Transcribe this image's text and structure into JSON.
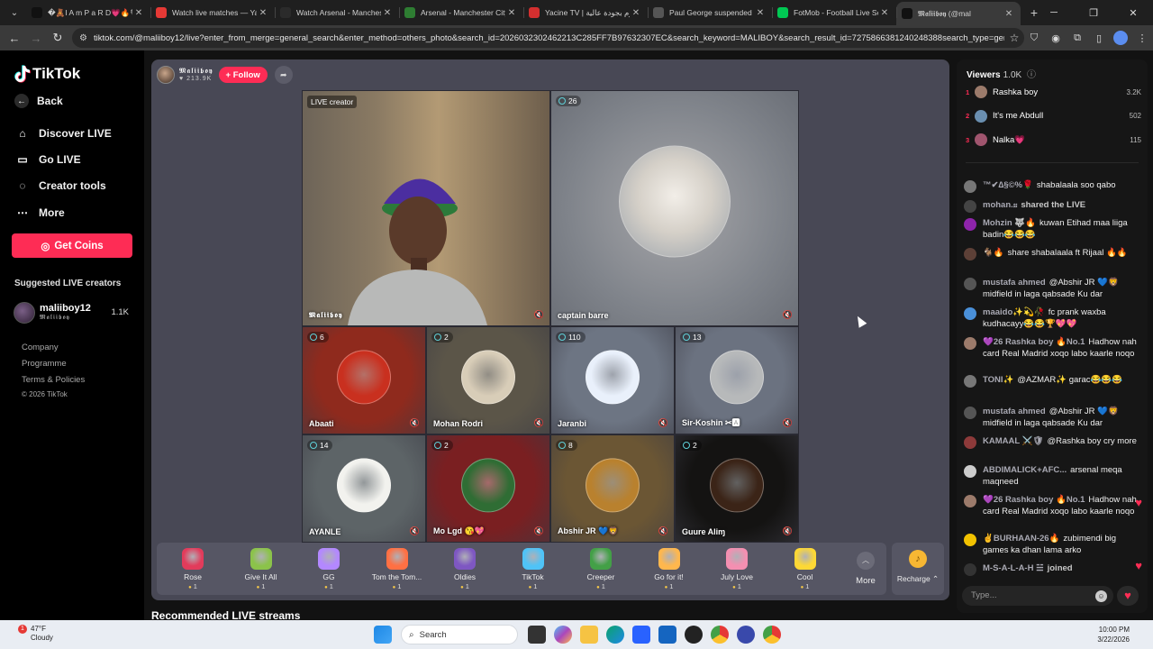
{
  "browser": {
    "tabs": [
      {
        "label": "�🧸I A m P a R D💗🔥🕊",
        "active": false,
        "favicon_color": "#111111",
        "icon": "tiktok-icon"
      },
      {
        "label": "Watch live matches — Ya",
        "active": false,
        "favicon_color": "#e53935",
        "icon": "y-icon"
      },
      {
        "label": "Watch Arsenal - Manches",
        "active": false,
        "favicon_color": "#2b2b2b",
        "icon": "check-icon"
      },
      {
        "label": "Arsenal - Manchester City",
        "active": false,
        "favicon_color": "#2e7d32",
        "icon": "s-icon"
      },
      {
        "label": "Yacine TV | يوم بجودة عالية",
        "active": false,
        "favicon_color": "#d32f2f",
        "icon": "y-icon"
      },
      {
        "label": "Paul George suspended f",
        "active": false,
        "favicon_color": "#555555",
        "icon": "globe-icon"
      },
      {
        "label": "FotMob - Football Live Sc",
        "active": false,
        "favicon_color": "#00c853",
        "icon": "fotmob-icon"
      },
      {
        "label": "𝕸𝖆𝖑𝖎𝖎𝖇𝖔𝖞 (@mal",
        "active": true,
        "favicon_color": "#111111",
        "icon": "tiktok-icon"
      }
    ],
    "new_tab": "+",
    "url": "tiktok.com/@maliiboy12/live?enter_from_merge=general_search&enter_method=others_photo&search_id=2026032302462213C285FF7B97632307EC&search_keyword=MALIBOY&search_result_id=7275866381240248388search_type=general"
  },
  "sidebar": {
    "logo_text": "TikTok",
    "back": "Back",
    "items": [
      {
        "label": "Discover LIVE",
        "icon": "home-icon"
      },
      {
        "label": "Go LIVE",
        "icon": "camera-icon"
      },
      {
        "label": "Creator tools",
        "icon": "lightbulb-icon"
      },
      {
        "label": "More",
        "icon": "ellipsis-icon"
      }
    ],
    "get_coins": "Get Coins",
    "suggested_heading": "Suggested LIVE creators",
    "suggested": {
      "name": "maliiboy12",
      "sub": "𝕸𝖆𝖑𝖎𝖎𝖇𝖔𝖞",
      "count": "1.1K"
    },
    "footer": [
      "Company",
      "Programme",
      "Terms & Policies",
      "© 2026 TikTok"
    ]
  },
  "host": {
    "name": "𝕸𝖆𝖑𝖎𝖎𝖇𝖔𝖞",
    "likes": "♥ 213.9K",
    "follow": "+ Follow"
  },
  "grid": {
    "main": [
      {
        "tag": "LIVE creator",
        "name": "𝕸𝖆𝖑𝖎𝖎𝖇𝖔𝖞",
        "bg": "#7a6a58"
      },
      {
        "badge": "26",
        "name": "captain barre",
        "bg": "#8a8e96"
      }
    ],
    "small": [
      {
        "badge": "6",
        "name": "Abaati",
        "bg": "#8f2a1d",
        "avatar": "#c9301f"
      },
      {
        "badge": "2",
        "name": "Mohan Rodri",
        "bg": "#5b5548",
        "avatar": "#d8cdb8"
      },
      {
        "badge": "110",
        "name": "Jaranbi",
        "bg": "#6d7583",
        "avatar": "#e9f0fb"
      },
      {
        "badge": "13",
        "name": "Sir-Koshin ✂🅰",
        "bg": "#6b7280",
        "avatar": "#b7b9ba"
      },
      {
        "badge": "14",
        "name": "AYANLE",
        "bg": "#5d6467",
        "avatar": "#f2f2ee"
      },
      {
        "badge": "2",
        "name": "Mo Lgd 😘💖",
        "bg": "#7a1f21",
        "avatar": "#2f6d34"
      },
      {
        "badge": "8",
        "name": "Abshir JR 💙🦁",
        "bg": "#6b5634",
        "avatar": "#b9812e"
      },
      {
        "badge": "2",
        "name": "Guure Aliɱ",
        "bg": "#141312",
        "avatar": "#3b2417"
      }
    ]
  },
  "gifts": [
    {
      "label": "Rose",
      "price": "1",
      "color": "#e23b5b"
    },
    {
      "label": "Give It All",
      "price": "1",
      "color": "#8bc34a"
    },
    {
      "label": "GG",
      "price": "1",
      "color": "#b388ff"
    },
    {
      "label": "Tom the Tom...",
      "price": "1",
      "color": "#ff7043"
    },
    {
      "label": "Oldies",
      "price": "1",
      "color": "#7e57c2"
    },
    {
      "label": "TikTok",
      "price": "1",
      "color": "#4fc3f7"
    },
    {
      "label": "Creeper",
      "price": "1",
      "color": "#43a047"
    },
    {
      "label": "Go for it!",
      "price": "1",
      "color": "#ffb74d"
    },
    {
      "label": "July Love",
      "price": "1",
      "color": "#f48fb1"
    },
    {
      "label": "Cool",
      "price": "1",
      "color": "#fdd835"
    }
  ],
  "more_label": "More",
  "recharge_label": "Recharge ⌃",
  "recommended_heading": "Recommended LIVE streams",
  "chat": {
    "viewers_title": "Viewers",
    "viewers_count": "1.0K",
    "top_viewers": [
      {
        "rank": "1",
        "name": "Rashka boy",
        "score": "3.2K",
        "color": "#9c7b6b"
      },
      {
        "rank": "2",
        "name": "It's me Abdull",
        "score": "502",
        "color": "#6a8fb0"
      },
      {
        "rank": "3",
        "name": "Nalka💗",
        "score": "115",
        "color": "#a0556e"
      }
    ],
    "messages": [
      {
        "user": "™✔∆§©%🌹",
        "text": "shabalaala soo qabo",
        "color": "#777777"
      },
      {
        "user": "mohan.᎓᎓",
        "text": "shared the LIVE",
        "color": "#444444"
      },
      {
        "user": "Mohzin 🐺🔥",
        "text": "kuwan Etihad maa liiga badin😂😂😂",
        "color": "#8e24aa"
      },
      {
        "user": "🐐🔥",
        "text": "share shabalaala ft Rijaal 🔥🔥",
        "color": "#5d4037"
      },
      {
        "user": "mustafa ahmed",
        "text": "@Abshir JR 💙🦁 midfield in laga qabsade Ku dar",
        "color": "#555555"
      },
      {
        "user": "maaido✨💫🥀",
        "text": "fc prank waxba kudhacayy😂😂🏆💖💖",
        "color": "#4a90d9"
      },
      {
        "user": "💜26 Rashka boy 🔥No.1",
        "text": "Hadhow nah card Real Madrid xoqo labo kaarle noqo",
        "color": "#9c7b6b"
      },
      {
        "user": "TONI✨",
        "text": "@AZMAR✨ garac😂😂😂",
        "color": "#777777"
      },
      {
        "user": "mustafa ahmed",
        "text": "@Abshir JR 💙🦁 midfield in laga qabsade Ku dar",
        "color": "#555555"
      },
      {
        "user": "KAMAAL ⚔️🛡",
        "text": "@Rashka boy cry more",
        "color": "#8d3a3a"
      },
      {
        "user": "ABDIMALICK+AFC...",
        "text": "arsenal meqa maqneed",
        "color": "#cccccc"
      },
      {
        "user": "💜26 Rashka boy 🔥No.1",
        "text": "Hadhow nah card Real Madrid xoqo labo kaarle noqo",
        "color": "#9c7b6b"
      },
      {
        "user": "✌BURHAAN-26🔥",
        "text": "zubimendi big games ka dhan lama arko",
        "color": "#f2c200"
      },
      {
        "user": "M-S-A-L-A-H ☱",
        "text": "joined",
        "color": "#333333"
      }
    ],
    "input_placeholder": "Type..."
  },
  "taskbar": {
    "weather_temp": "47°F",
    "weather_desc": "Cloudy",
    "search": "Search",
    "time": "10:00 PM",
    "date": "3/22/2026"
  }
}
